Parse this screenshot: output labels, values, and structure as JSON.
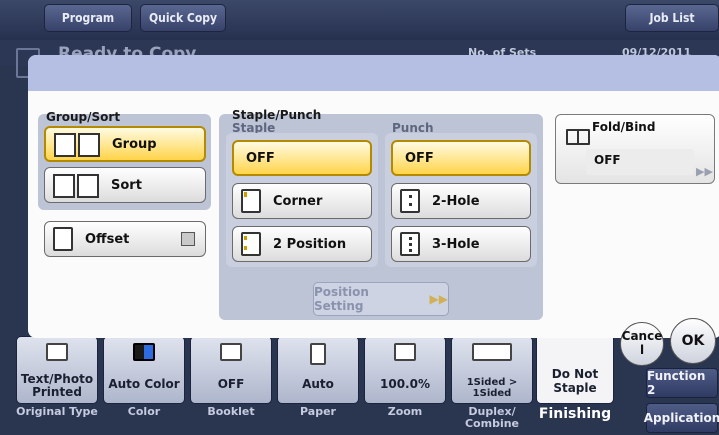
{
  "topbar": {
    "program": "Program",
    "quick_copy": "Quick Copy",
    "job_list": "Job List"
  },
  "status": {
    "ready": "Ready to Copy",
    "sets": "No. of Sets",
    "date": "09/12/2011"
  },
  "group_sort": {
    "label": "Group/Sort",
    "group": "Group",
    "sort": "Sort",
    "offset": "Offset"
  },
  "staple_punch": {
    "label": "Staple/Punch",
    "staple_label": "Staple",
    "punch_label": "Punch",
    "staple_off": "OFF",
    "corner": "Corner",
    "two_position": "2 Position",
    "punch_off": "OFF",
    "two_hole": "2-Hole",
    "three_hole": "3-Hole",
    "position_setting": "Position Setting",
    "position_setting_arrow": "▶▶"
  },
  "fold_bind": {
    "label": "Fold/Bind",
    "value": "OFF",
    "arrow": "▶▶"
  },
  "functions": [
    {
      "value": "Text/Photo\nPrinted",
      "label": "Original Type"
    },
    {
      "value": "Auto Color",
      "label": "Color"
    },
    {
      "value": "OFF",
      "label": "Booklet"
    },
    {
      "value": "Auto",
      "label": "Paper"
    },
    {
      "value": "100.0%",
      "label": "Zoom"
    },
    {
      "value": "1Sided > 1Sided",
      "label": "Duplex/\nCombine"
    }
  ],
  "finishing": {
    "value": "Do Not\nStaple",
    "label": "Finishing"
  },
  "right_buttons": {
    "function2": "Function 2",
    "application": "Application"
  },
  "dialog": {
    "cancel": "Cance\nl",
    "ok": "OK"
  },
  "colors": {
    "selected": "#ffd44a",
    "panel_band": "#b5bfe4",
    "background": "#2a3550"
  }
}
